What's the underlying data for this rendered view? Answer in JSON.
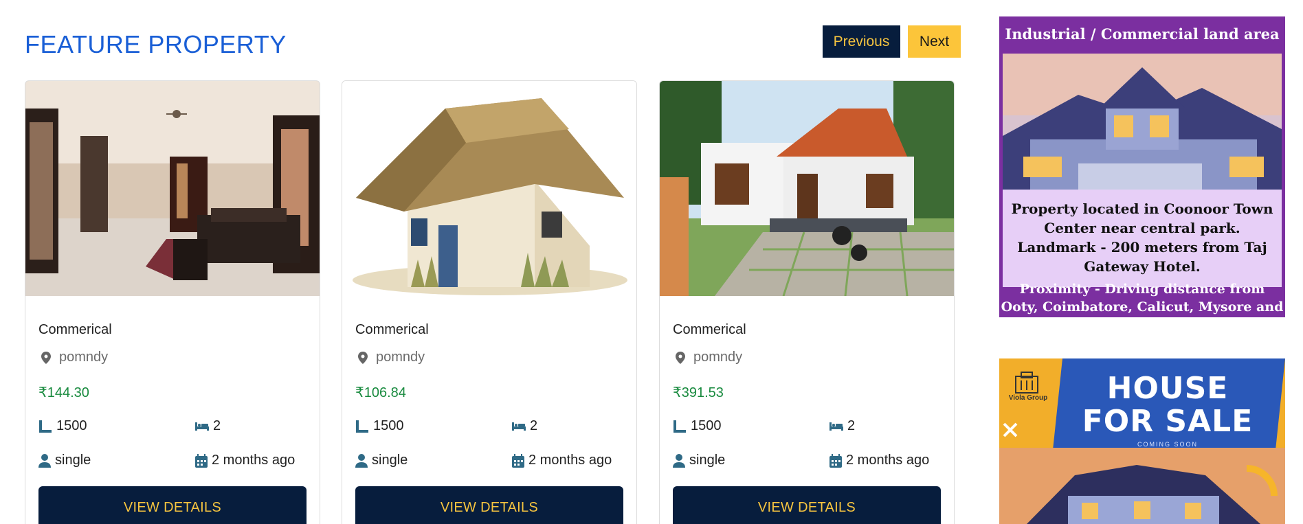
{
  "section": {
    "title": "FEATURE PROPERTY",
    "prev_label": "Previous",
    "next_label": "Next"
  },
  "cards": [
    {
      "type": "Commerical",
      "location": "pomndy",
      "price": "₹144.30",
      "area": "1500",
      "beds": "2",
      "occupancy": "single",
      "posted": "2 months ago",
      "button": "VIEW DETAILS"
    },
    {
      "type": "Commerical",
      "location": "pomndy",
      "price": "₹106.84",
      "area": "1500",
      "beds": "2",
      "occupancy": "single",
      "posted": "2 months ago",
      "button": "VIEW DETAILS"
    },
    {
      "type": "Commerical",
      "location": "pomndy",
      "price": "₹391.53",
      "area": "1500",
      "beds": "2",
      "occupancy": "single",
      "posted": "2 months ago",
      "button": "VIEW DETAILS"
    }
  ],
  "ads": {
    "ad1": {
      "title": "Industrial / Commercial land area",
      "description": "Property located in Coonoor Town Center near central park. Landmark - 200 meters from Taj Gateway Hotel.",
      "proximity": "Proximity - Driving distance from Ooty, Coimbatore, Calicut, Mysore and"
    },
    "ad2": {
      "brand": "Viola Group",
      "headline_line1": "HOUSE",
      "headline_line2": "FOR SALE",
      "subline": "COMING SOON"
    }
  },
  "icons": {
    "location": "map-pin-icon",
    "area": "ruler-icon",
    "beds": "bed-icon",
    "occupancy": "user-icon",
    "posted": "calendar-icon"
  },
  "colors": {
    "title_blue": "#1a5fd6",
    "navy": "#071d3d",
    "gold": "#f6c43f",
    "price_green": "#188a3e",
    "icon_teal": "#2f6a86",
    "ad_purple": "#7b2fa0"
  }
}
